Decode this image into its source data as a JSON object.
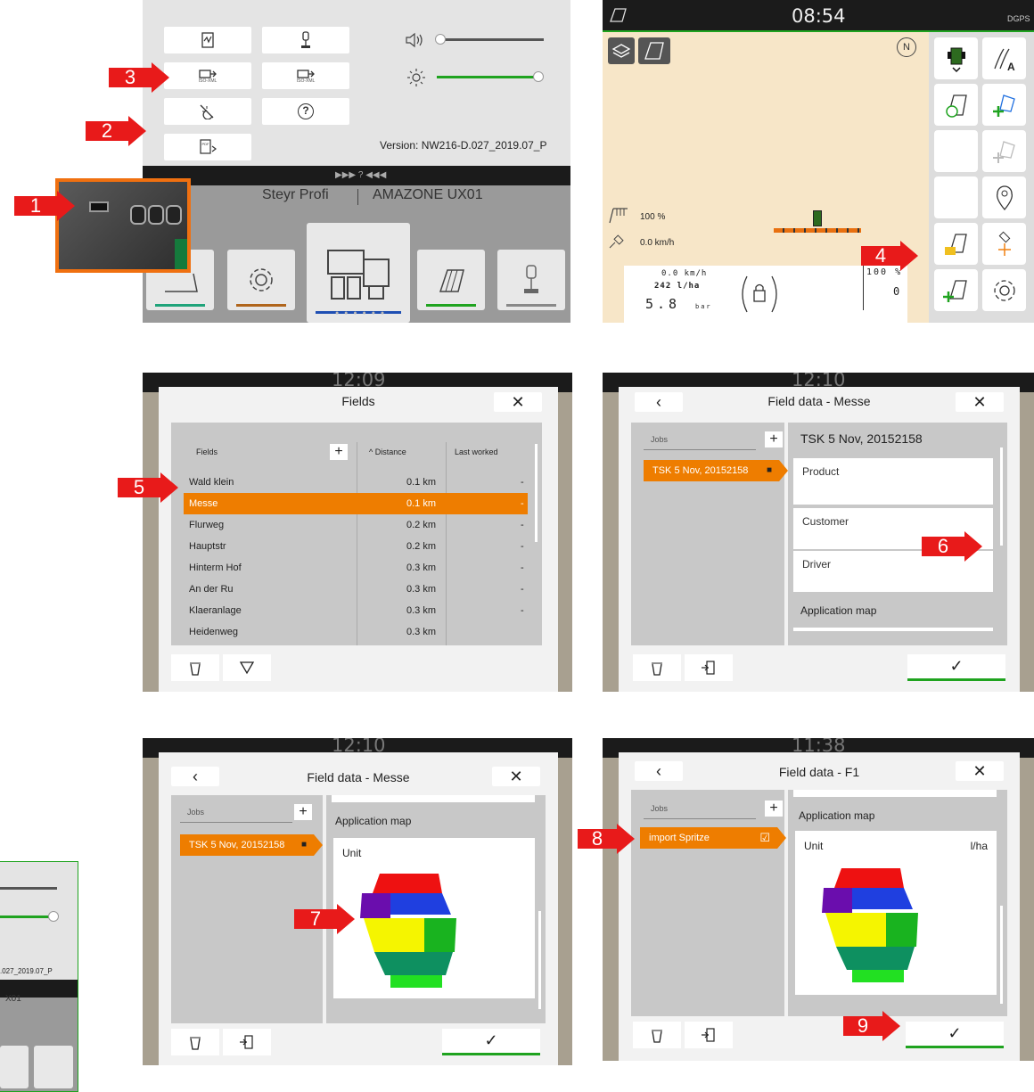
{
  "steps": [
    "1",
    "2",
    "3",
    "4",
    "5",
    "6",
    "7",
    "8",
    "9"
  ],
  "panel1": {
    "version": "Version: NW216-D.027_2019.07_P",
    "iso_xml_label": "ISO-XML",
    "tractor": "Steyr Profi",
    "implement": "AMAZONE UX01",
    "help_glyph": "?",
    "statusbar_glyphs": "▶▶▶  ?  ◀◀◀"
  },
  "panel2": {
    "time": "08:54",
    "dgps": "DGPS",
    "rate": "100 %",
    "speed": "0.0 km/h",
    "gauge_speed": "0.0 km/h",
    "gauge_rate": "242 l/ha",
    "gauge_pressure": "5.8",
    "gauge_unit": "bar",
    "gauge_right_pct": "100 %",
    "gauge_right_val": "0",
    "compass": "N"
  },
  "panel3": {
    "time": "12:09",
    "title": "Fields",
    "col_fields": "Fields",
    "col_distance": "^ Distance",
    "col_last": "Last worked",
    "rows": [
      {
        "name": "Wald klein",
        "dist": "0.1 km",
        "last": "-"
      },
      {
        "name": "Messe",
        "dist": "0.1 km",
        "last": "-"
      },
      {
        "name": "Flurweg",
        "dist": "0.2 km",
        "last": "-"
      },
      {
        "name": "Hauptstr",
        "dist": "0.2 km",
        "last": "-"
      },
      {
        "name": "Hinterm Hof",
        "dist": "0.3 km",
        "last": "-"
      },
      {
        "name": "An der Ru",
        "dist": "0.3 km",
        "last": "-"
      },
      {
        "name": "Klaeranlage",
        "dist": "0.3 km",
        "last": "-"
      },
      {
        "name": "Heidenweg",
        "dist": "0.3 km",
        "last": ""
      }
    ]
  },
  "panel4": {
    "time": "12:10",
    "title": "Field data - Messe",
    "jobs_label": "Jobs",
    "job": "TSK 5 Nov, 20152158",
    "heading": "TSK 5 Nov, 20152158",
    "cards": [
      "Product",
      "Customer",
      "Driver"
    ],
    "app_map": "Application map"
  },
  "panel5": {
    "time": "12:10",
    "title": "Field data - Messe",
    "jobs_label": "Jobs",
    "job": "TSK 5 Nov, 20152158",
    "app_map": "Application map",
    "unit": "Unit"
  },
  "panel6": {
    "time": "11:38",
    "title": "Field data - F1",
    "jobs_label": "Jobs",
    "job": "import Spritze",
    "app_map": "Application map",
    "unit": "Unit",
    "unit_value": "l/ha"
  },
  "panel7": {
    "version_fragment": ".027_2019.07_P",
    "implement_fragment": "X01"
  },
  "glyphs": {
    "close": "✕",
    "back": "‹",
    "check": "✓",
    "plus": "+",
    "checkbox": "☑",
    "square": "■"
  },
  "colors": {
    "accent_orange": "#ee7d00",
    "step_red": "#e81a1a",
    "ok_green": "#1fa31f",
    "map_red": "#ee1111",
    "map_blue": "#1f3fe0",
    "map_purple": "#6a0dad",
    "map_yellow": "#f5f500",
    "map_green": "#19b31f",
    "map_dark_green": "#0e9060",
    "map_light_green": "#22e022"
  }
}
